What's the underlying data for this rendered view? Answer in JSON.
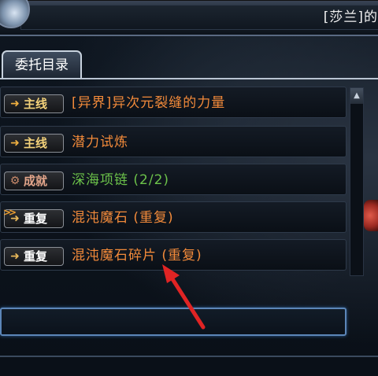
{
  "window": {
    "npc_title": "[莎兰]的"
  },
  "tabs": [
    {
      "label": "委托目录",
      "active": true
    }
  ],
  "quests": [
    {
      "type": "主线",
      "type_color": "#f4d27a",
      "icon": "arrow-icon",
      "icon_color": "#f0b040",
      "name": "[异界]异次元裂缝的力量",
      "name_color": "#f28a3a"
    },
    {
      "type": "主线",
      "type_color": "#f4d27a",
      "icon": "arrow-icon",
      "icon_color": "#f0b040",
      "name": "潜力试炼",
      "name_color": "#f28a3a"
    },
    {
      "type": "成就",
      "type_color": "#e2a58a",
      "icon": "gear-icon",
      "icon_color": "#c98a6a",
      "name": "深海项链 (2/2)",
      "name_color": "#6cc24a"
    },
    {
      "type": "重复",
      "type_color": "#ffffff",
      "icon": "arrow-icon",
      "icon_color": "#e8b85a",
      "name": "混沌魔石 (重复)",
      "name_color": "#f28a3a",
      "marker": ">>"
    },
    {
      "type": "重复",
      "type_color": "#ffffff",
      "icon": "arrow-icon",
      "icon_color": "#e8b85a",
      "name": "混沌魔石碎片 (重复)",
      "name_color": "#f28a3a"
    }
  ],
  "scrollbar": {
    "up_icon": "▲"
  },
  "accent_colors": {
    "annotation_arrow": "#e02424",
    "input_border": "#5c86b8"
  }
}
